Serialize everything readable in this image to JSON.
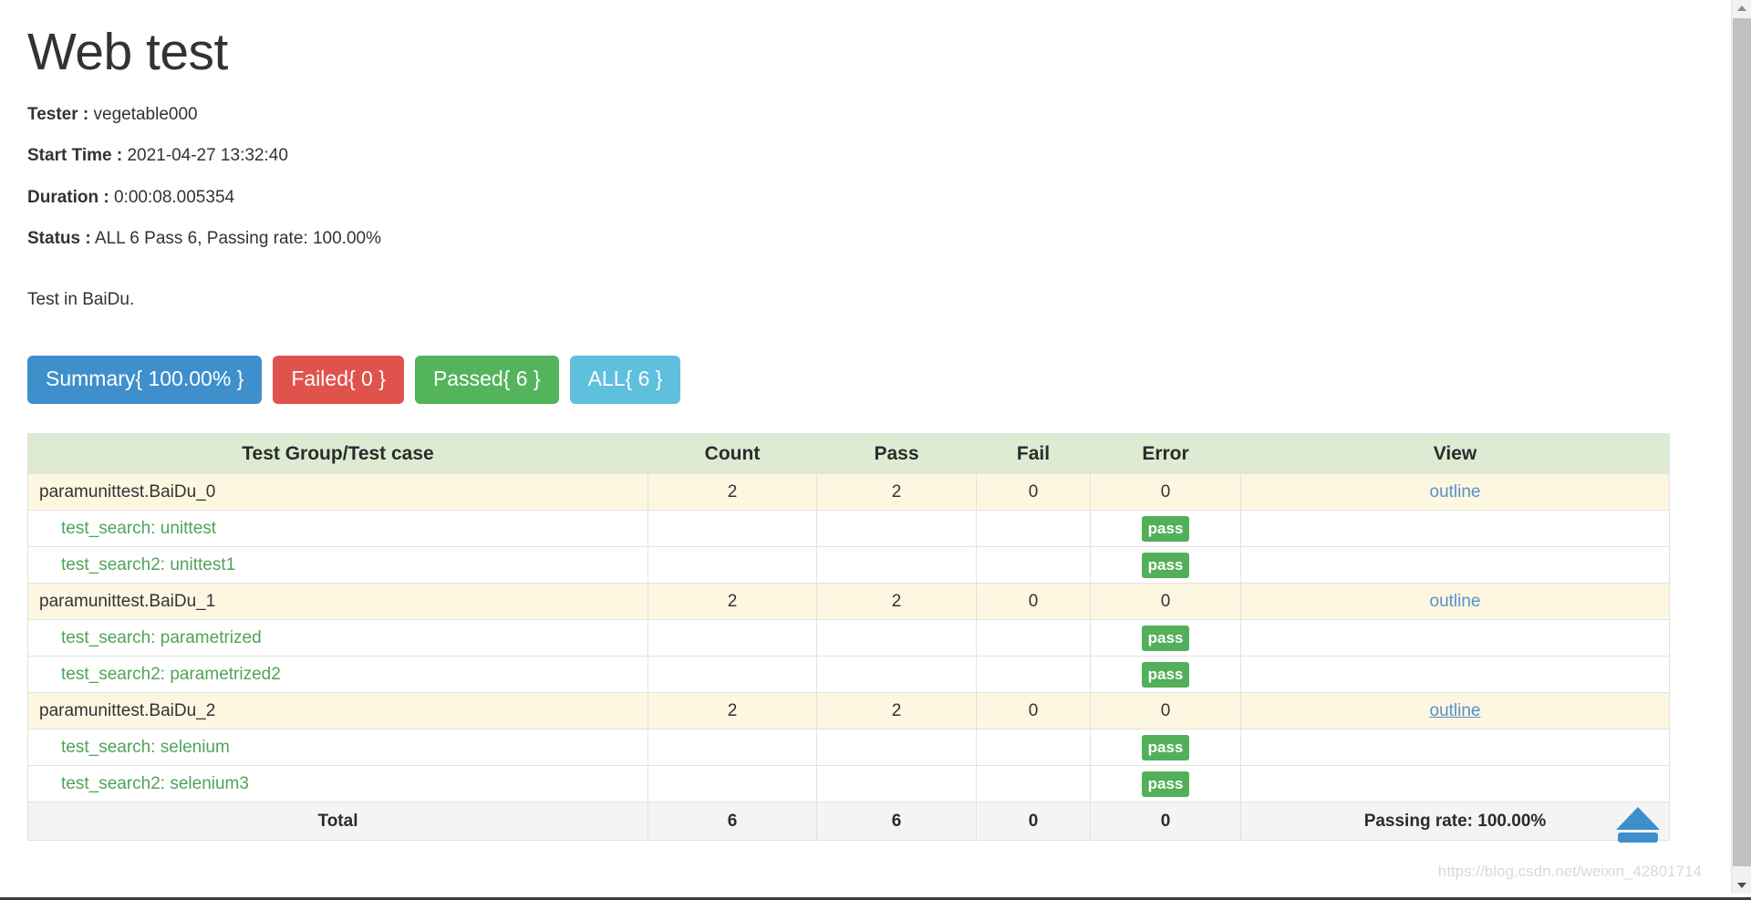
{
  "report": {
    "title": "Web test",
    "meta": [
      {
        "key": "Tester :",
        "value": "vegetable000"
      },
      {
        "key": "Start Time :",
        "value": "2021-04-27 13:32:40"
      },
      {
        "key": "Duration :",
        "value": "0:00:08.005354"
      },
      {
        "key": "Status :",
        "value": "ALL 6 Pass 6, Passing rate: 100.00%"
      }
    ],
    "description": "Test in BaiDu."
  },
  "filters": {
    "summary": {
      "label": "Summary{ 100.00% }",
      "color": "#3f8fcd"
    },
    "failed": {
      "label": "Failed{ 0 }",
      "color": "#e0534d"
    },
    "passed": {
      "label": "Passed{ 6 }",
      "color": "#53b45b"
    },
    "all": {
      "label": "ALL{ 6 }",
      "color": "#5fc0de"
    }
  },
  "table": {
    "headers": [
      "Test Group/Test case",
      "Count",
      "Pass",
      "Fail",
      "Error",
      "View"
    ],
    "groups": [
      {
        "name": "paramunittest.BaiDu_0",
        "count": "2",
        "pass": "2",
        "fail": "0",
        "error": "0",
        "view": "outline",
        "view_hovered": false,
        "cases": [
          {
            "name": "test_search: unittest",
            "status": "pass"
          },
          {
            "name": "test_search2: unittest1",
            "status": "pass"
          }
        ]
      },
      {
        "name": "paramunittest.BaiDu_1",
        "count": "2",
        "pass": "2",
        "fail": "0",
        "error": "0",
        "view": "outline",
        "view_hovered": false,
        "cases": [
          {
            "name": "test_search: parametrized",
            "status": "pass"
          },
          {
            "name": "test_search2: parametrized2",
            "status": "pass"
          }
        ]
      },
      {
        "name": "paramunittest.BaiDu_2",
        "count": "2",
        "pass": "2",
        "fail": "0",
        "error": "0",
        "view": "outline",
        "view_hovered": true,
        "cases": [
          {
            "name": "test_search: selenium",
            "status": "pass"
          },
          {
            "name": "test_search2: selenium3",
            "status": "pass"
          }
        ]
      }
    ],
    "total": {
      "label": "Total",
      "count": "6",
      "pass": "6",
      "fail": "0",
      "error": "0",
      "view": "Passing rate: 100.00%"
    }
  },
  "controls": {
    "scroll_top": "scroll-to-top",
    "watermark": "https://blog.csdn.net/weixin_42801714"
  }
}
